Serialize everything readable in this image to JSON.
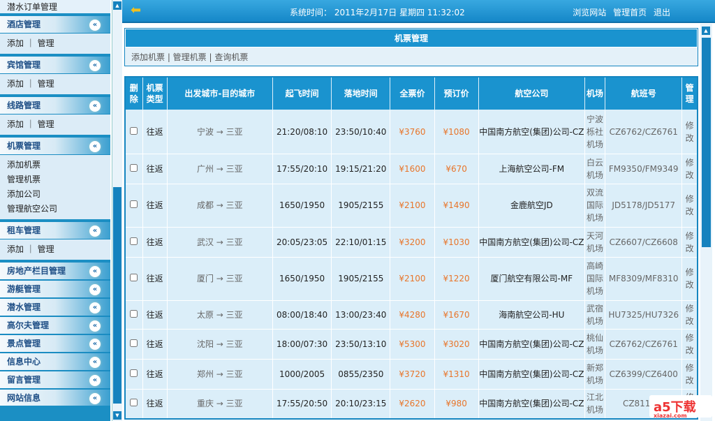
{
  "sidebar": {
    "top_item": "潜水订单管理",
    "sections": [
      {
        "title": "酒店管理",
        "items": [
          "添加 ｜ 管理"
        ]
      },
      {
        "title": "宾馆管理",
        "items": [
          "添加 ｜ 管理"
        ]
      },
      {
        "title": "线路管理",
        "items": [
          "添加 ｜ 管理"
        ]
      },
      {
        "title": "机票管理",
        "items": [
          "添加机票",
          "管理机票",
          "添加公司",
          "管理航空公司"
        ]
      },
      {
        "title": "租车管理",
        "items": [
          "添加 ｜ 管理"
        ]
      },
      {
        "title": "房地产栏目管理",
        "items": []
      },
      {
        "title": "游艇管理",
        "items": []
      },
      {
        "title": "潜水管理",
        "items": []
      },
      {
        "title": "高尔夫管理",
        "items": []
      },
      {
        "title": "景点管理",
        "items": []
      },
      {
        "title": "信息中心",
        "items": []
      },
      {
        "title": "留言管理",
        "items": []
      },
      {
        "title": "网站信息",
        "items": []
      }
    ],
    "chevron": "«"
  },
  "topbar": {
    "system_time": "系统时间： 2011年2月17日 星期四 11:32:02",
    "links": [
      "浏览网站",
      "管理首页",
      "退出"
    ]
  },
  "panel": {
    "title": "机票管理",
    "ops": "添加机票 | 管理机票 | 查询机票"
  },
  "table": {
    "headers": [
      "删除",
      "机票类型",
      "出发城市-目的城市",
      "起飞时间",
      "落地时间",
      "全票价",
      "预订价",
      "航空公司",
      "机场",
      "航班号",
      "管理"
    ],
    "rows": [
      {
        "type": "往返",
        "route": "宁波 → 三亚",
        "dep": "21:20/08:10",
        "arr": "23:50/10:40",
        "full": "¥3760",
        "book": "¥1080",
        "airline": "中国南方航空(集团)公司-CZ",
        "airport": "宁波栎社机场",
        "flight": "CZ6762/CZ6761",
        "op": "修改"
      },
      {
        "type": "往返",
        "route": "广州 → 三亚",
        "dep": "17:55/20:10",
        "arr": "19:15/21:20",
        "full": "¥1600",
        "book": "¥670",
        "airline": "上海航空公司-FM",
        "airport": "白云机场",
        "flight": "FM9350/FM9349",
        "op": "修改"
      },
      {
        "type": "往返",
        "route": "成都 → 三亚",
        "dep": "1650/1950",
        "arr": "1905/2155",
        "full": "¥2100",
        "book": "¥1490",
        "airline": "金鹿航空JD",
        "airport": "双流国际机场",
        "flight": "JD5178/JD5177",
        "op": "修改"
      },
      {
        "type": "往返",
        "route": "武汉 → 三亚",
        "dep": "20:05/23:05",
        "arr": "22:10/01:15",
        "full": "¥3200",
        "book": "¥1030",
        "airline": "中国南方航空(集团)公司-CZ",
        "airport": "天河机场",
        "flight": "CZ6607/CZ6608",
        "op": "修改"
      },
      {
        "type": "往返",
        "route": "厦门 → 三亚",
        "dep": "1650/1950",
        "arr": "1905/2155",
        "full": "¥2100",
        "book": "¥1220",
        "airline": "厦门航空有限公司-MF",
        "airport": "高崎国际机场",
        "flight": "MF8309/MF8310",
        "op": "修改"
      },
      {
        "type": "往返",
        "route": "太原 → 三亚",
        "dep": "08:00/18:40",
        "arr": "13:00/23:40",
        "full": "¥4280",
        "book": "¥1670",
        "airline": "海南航空公司-HU",
        "airport": "武宿机场",
        "flight": "HU7325/HU7326",
        "op": "修改"
      },
      {
        "type": "往返",
        "route": "沈阳 → 三亚",
        "dep": "18:00/07:30",
        "arr": "23:50/13:10",
        "full": "¥5300",
        "book": "¥3020",
        "airline": "中国南方航空(集团)公司-CZ",
        "airport": "桃仙机场",
        "flight": "CZ6762/CZ6761",
        "op": "修改"
      },
      {
        "type": "往返",
        "route": "郑州 → 三亚",
        "dep": "1000/2005",
        "arr": "0855/2350",
        "full": "¥3720",
        "book": "¥1310",
        "airline": "中国南方航空(集团)公司-CZ",
        "airport": "新郑机场",
        "flight": "CZ6399/CZ6400",
        "op": "修改"
      },
      {
        "type": "往返",
        "route": "重庆 → 三亚",
        "dep": "17:55/20:50",
        "arr": "20:10/23:15",
        "full": "¥2620",
        "book": "¥980",
        "airline": "中国南方航空(集团)公司-CZ",
        "airport": "江北机场",
        "flight": "CZ8111/C",
        "op": "修改"
      }
    ]
  },
  "watermark": {
    "text": "a5下载",
    "sub": "xiazai.com"
  }
}
